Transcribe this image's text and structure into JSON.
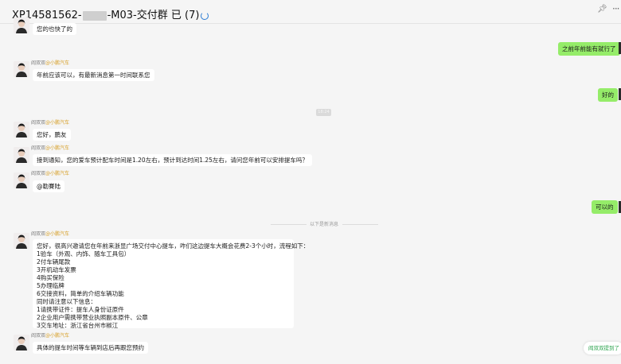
{
  "window": {
    "title_prefix": "XP14581562-",
    "title_suffix": "-M03-交付群 已 (7)"
  },
  "messages": [
    {
      "id": "m1",
      "text": "您的也快了的"
    },
    {
      "id": "m2",
      "text": "之前年前能有就行了"
    },
    {
      "id": "m3",
      "sender": "阎双双",
      "brand": "@小鹏汽车",
      "text": "年前应该可以，有最新消息第一时间联系您"
    },
    {
      "id": "m4",
      "text": "好的"
    },
    {
      "id": "m5",
      "sender": "阎双双",
      "brand": "@小鹏汽车",
      "text": "您好，鹏友"
    },
    {
      "id": "m6",
      "sender": "阎双双",
      "brand": "@小鹏汽车",
      "text": "接到通知，您的爱车预计配车时间是1.20左右，预计到达时间1.25左右，请问您年前可以安排提车吗？"
    },
    {
      "id": "m7",
      "sender": "阎双双",
      "brand": "@小鹏汽车",
      "text": "@勒賽陆"
    },
    {
      "id": "m8",
      "text": "可以的"
    },
    {
      "id": "m9",
      "sender": "阎双双",
      "brand": "@小鹏汽车",
      "lines": [
        "您好，很高兴邀请您在年前来浙显广场交付中心提车，咋们这边提车大概会花费2-3个小时，流程如下：",
        "1验车（外观、内饰、随车工具包）",
        "2付车辆尾款",
        "3开机动车发票",
        "4购买保险",
        "5办理临牌",
        "6交接资料，简单的介绍车辆功能",
        "同时请注意以下信息：",
        "1请携带证件：提车人身份证原件",
        "2企业用户需携带营业执照副本原件、公章",
        "3交车地址：浙江省台州市椒江"
      ]
    },
    {
      "id": "m10",
      "sender": "阎双双",
      "brand": "@小鹏汽车",
      "text": "具体的提车时间等车辆到店后再跟您预约"
    }
  ],
  "time_separator": "18:24",
  "new_messages_divider": "以下是新消息",
  "toast": {
    "text": "阎双双提到了"
  },
  "colors": {
    "own_bubble": "#95ec69",
    "brand": "#d7a12b",
    "toast_text": "#2ea44f",
    "background": "#f5f5f5"
  }
}
